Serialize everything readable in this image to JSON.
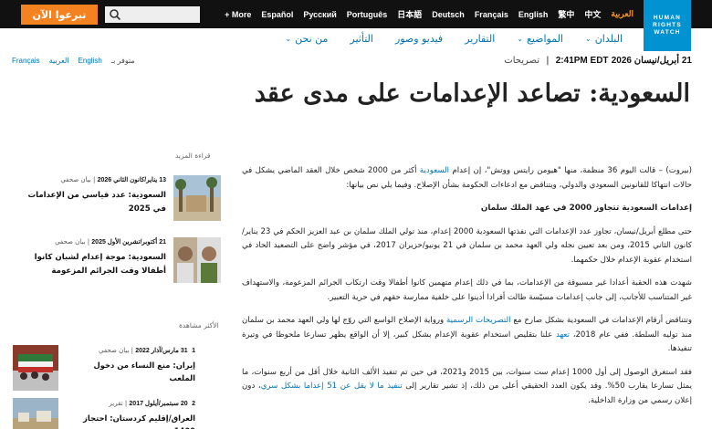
{
  "topbar": {
    "donate_label": "تبرعوا الآن",
    "search_icon": "search-icon",
    "languages": [
      "العربية",
      "中文",
      "繁中",
      "English",
      "Français",
      "Deutsch",
      "日本語",
      "Português",
      "Русский",
      "Español",
      "+ More"
    ],
    "active_language": "العربية"
  },
  "logo": {
    "lines": [
      "HUMAN",
      "RIGHTS",
      "WATCH"
    ],
    "color": "#0092d1"
  },
  "nav": {
    "items": [
      "البلدان",
      "المواضيع",
      "التقارير",
      "فيديو وصور",
      "التأثير",
      "من نحن"
    ],
    "chevron_icon": "chevron-down-icon",
    "link_color": "#0074b3"
  },
  "meta": {
    "date": "21 أبريل/نيسان 2026",
    "time": "2:41PM EDT",
    "type": "تصريحات",
    "available_label": "متوفر بـ",
    "available_languages": [
      "English",
      "العربية",
      "Français"
    ]
  },
  "article": {
    "title": "السعودية: تصاعد الإعدامات على مدى عقد",
    "p1_before": "(بيروت) – قالت اليوم 36 منظمة، منها \"هيومن رايتس ووتش\"، إن إعدام ",
    "p1_link": "السعودية",
    "p1_after": " أكثر من 2000 شخص خلال العقد الماضي يشكل في حالات انتهاكا للقانونين السعودي والدولي، ويتناقض مع ادعاءات الحكومة بشأن الإصلاح. وفيما يلي نص بيانها:",
    "heading": "إعدامات السعودية تتجاوز 2000 في عهد الملك سلمان",
    "p2": "حتى مطلع أبريل/نيسان، تجاوز عدد الإعدامات التي نفذتها السعودية 2000 إعدام، منذ تولي الملك سلمان بن عبد العزيز الحكم في 23 يناير/كانون الثاني 2015، ومن بعد تعيين نجله ولي العهد محمد بن سلمان في 21 يونيو/حزيران 2017، في مؤشر واضح على التصعيد الحاد في استخدام عقوبة الإعدام خلال حكمهما.",
    "p3": "شهدت هذه الحقبة أعدادا غير مسبوقة من الإعدامات، بما في ذلك إعدام متهمين كانوا أطفالا وقت ارتكاب الجرائم المزعومة، والاستهداف غير المتناسب للأجانب، إلى جانب إعدامات مسيّسة طالت أفرادا أدينوا على خلفية ممارسة حقهم في حرية التعبير.",
    "p4_a": "وتتناقض أرقام الإعدامات في السعودية بشكل صارخ مع ",
    "p4_link1": "التصريحات الرسمية",
    "p4_b": " ورواية الإصلاح الواسع التي روّج لها ولي العهد محمد بن سلمان منذ توليه السلطة. ففي عام 2018، ",
    "p4_link2": "تعهد",
    "p4_c": " علنا بتقليص استخدام عقوبة الإعدام بشكل كبير، إلا أن الواقع يظهر تسارعا ملحوظا في وتيرة تنفيذها.",
    "p5_a": "فقد استغرق الوصول إلى أول 1000 إعدام ست سنوات، بين 2015 و2021، في حين تم تنفيذ الألف الثانية خلال أقل من أربع سنوات، ما يمثل تسارعا يقارب 50%. وقد يكون العدد الحقيقي أعلى من ذلك، إذ تشير تقارير إلى ",
    "p5_link": "تنفيذ ما لا يقل عن 51 إعداما بشكل سري",
    "p5_b": "، دون إعلان رسمي من وزارة الداخلية."
  },
  "sidebar": {
    "read_more_label": "قراءة المزيد",
    "most_viewed_label": "الأكثر مشاهدة",
    "read_more": [
      {
        "date": "13 يناير/كانون الثاني 2026",
        "type": "بيان صحفي",
        "title": "السعودية: عدد قياسي من الإعدامات في 2025"
      },
      {
        "date": "21 أكتوبر/تشرين الأول 2025",
        "type": "بيان صحفي",
        "title": "السعودية: موجة إعدام لشبان كانوا أطفالا وقت الجرائم المزعومة"
      }
    ],
    "most_viewed": [
      {
        "rank": "1",
        "date": "31 مارس/آذار 2022",
        "type": "بيان صحفي",
        "title": "إيران: منع النساء من دخول الملعب"
      },
      {
        "rank": "2",
        "date": "20 سبتمبر/أيلول 2017",
        "type": "تقرير",
        "title": "العراق/إقليم كردستان: احتجاز 1400"
      }
    ]
  }
}
